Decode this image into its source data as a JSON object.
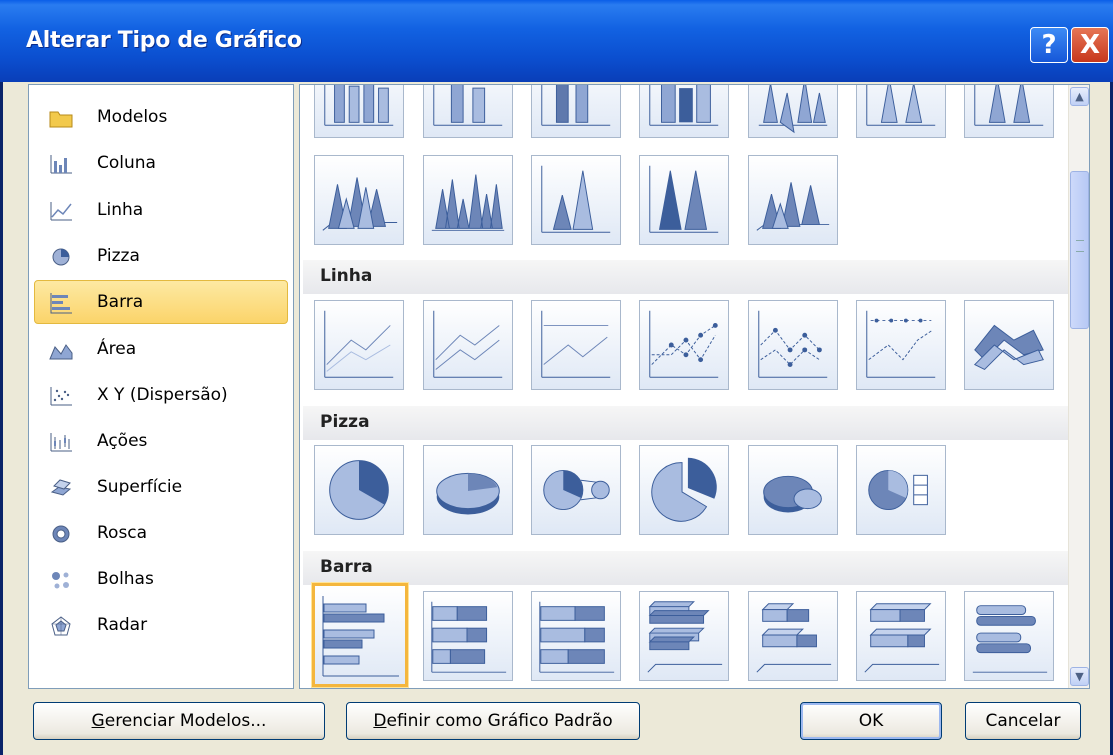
{
  "window": {
    "title": "Alterar Tipo de Gráfico",
    "help_label": "?",
    "close_label": "X"
  },
  "categories": [
    {
      "label": "Modelos",
      "icon": "folder-icon",
      "selected": false
    },
    {
      "label": "Coluna",
      "icon": "column-chart-icon",
      "selected": false
    },
    {
      "label": "Linha",
      "icon": "line-chart-icon",
      "selected": false
    },
    {
      "label": "Pizza",
      "icon": "pie-chart-icon",
      "selected": false
    },
    {
      "label": "Barra",
      "icon": "bar-chart-icon",
      "selected": true
    },
    {
      "label": "Área",
      "icon": "area-chart-icon",
      "selected": false
    },
    {
      "label": "X Y (Dispersão)",
      "icon": "scatter-chart-icon",
      "selected": false
    },
    {
      "label": "Ações",
      "icon": "stock-chart-icon",
      "selected": false
    },
    {
      "label": "Superfície",
      "icon": "surface-chart-icon",
      "selected": false
    },
    {
      "label": "Rosca",
      "icon": "doughnut-chart-icon",
      "selected": false
    },
    {
      "label": "Bolhas",
      "icon": "bubble-chart-icon",
      "selected": false
    },
    {
      "label": "Radar",
      "icon": "radar-chart-icon",
      "selected": false
    }
  ],
  "gallery": {
    "groups": [
      {
        "label": "Linha"
      },
      {
        "label": "Pizza"
      },
      {
        "label": "Barra"
      }
    ],
    "selected_thumb": "bar-clustered"
  },
  "buttons": {
    "manage_prefix": "G",
    "manage_rest": "erenciar Modelos...",
    "default_prefix": "D",
    "default_rest": "efinir como Gráfico Padrão",
    "ok": "OK",
    "cancel": "Cancelar"
  },
  "colors": {
    "accent": "#0a5ee8",
    "selection": "#fbd46a",
    "chart_blue": "#3c5e9b"
  }
}
